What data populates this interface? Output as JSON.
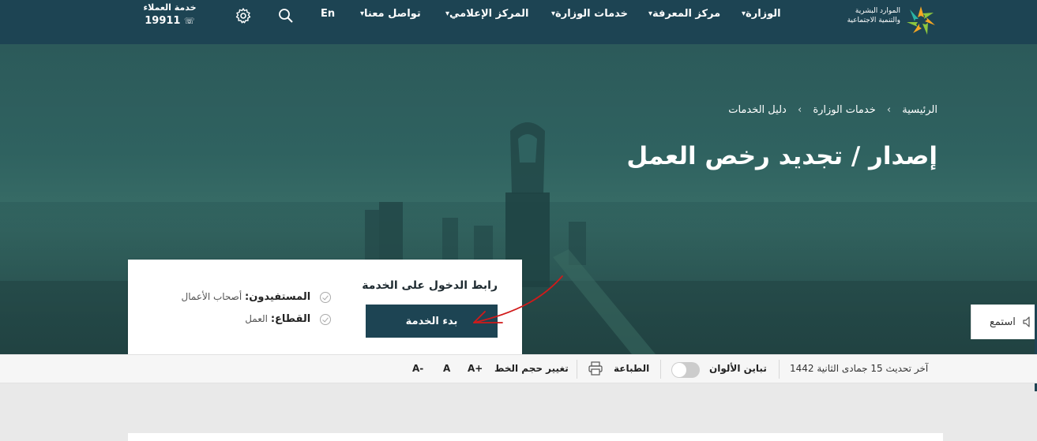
{
  "header": {
    "logo_line1": "الموارد البشرية",
    "logo_line2": "والتنمية الاجتماعية",
    "nav": [
      {
        "label": "الوزارة"
      },
      {
        "label": "مركز المعرفة"
      },
      {
        "label": "خدمات الوزارة"
      },
      {
        "label": "المركز الإعلامي"
      },
      {
        "label": "تواصل معنا"
      }
    ],
    "lang_label": "En",
    "hotline_label": "خدمة العملاء",
    "hotline_number": "19911"
  },
  "hero": {
    "breadcrumb": [
      "الرئيسية",
      "خدمات الوزارة",
      "دليل الخدمات"
    ],
    "breadcrumb_sep": "›",
    "title": "إصدار / تجديد رخص العمل"
  },
  "service_card": {
    "link_title": "رابط الدخول على الخدمة",
    "start_button": "بدء الخدمة",
    "beneficiaries_label": "المستفيدون:",
    "beneficiaries_value": "أصحاب الأعمال",
    "sector_label": "القطاع:",
    "sector_value": "العمل"
  },
  "listen": {
    "label": "استمع"
  },
  "toolbar": {
    "last_update": "آخر تحديث 15 جمادى الثانية 1442",
    "contrast_label": "تباين الألوان",
    "contrast_on": false,
    "print_label": "الطباعة",
    "font_size_label": "تغيير حجم الخط",
    "font_increase": "A+",
    "font_reset": "A",
    "font_decrease": "A-"
  },
  "colors": {
    "primary": "#1d4453",
    "hero": "#2f6260",
    "annotation": "#d11a1a"
  }
}
